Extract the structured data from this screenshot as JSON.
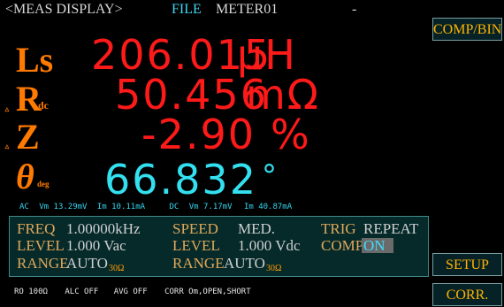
{
  "title_bar": {
    "mode": "<MEAS DISPLAY>",
    "file_label": "FILE",
    "file_name": "METER01",
    "dash": "-"
  },
  "side_buttons": {
    "comp_bin": "COMP/BIN",
    "setup": "SETUP",
    "corr": "CORR."
  },
  "readings": [
    {
      "label": "Ls",
      "sub": "",
      "prefix": "",
      "value": "206.015",
      "unit": "μH",
      "color": "#ff1a1a"
    },
    {
      "label": "R",
      "sub": "dc",
      "prefix": "▵",
      "value": "50.456",
      "unit": "mΩ",
      "color": "#ff1a1a"
    },
    {
      "label": "Z",
      "sub": "",
      "prefix": "▵",
      "value": "-2.90",
      "unit": "%",
      "color": "#ff1a1a"
    },
    {
      "label": "θ",
      "sub": "deg",
      "prefix": "",
      "value": "66.832",
      "unit": "°",
      "color": "#33e0f0"
    }
  ],
  "monitor": {
    "ac": "AC",
    "ac_vm": "Vm 13.29mV",
    "ac_im": "Im 10.11mA",
    "dc": "DC",
    "dc_vm": "Vm 7.17mV",
    "dc_im": "Im 40.87mA"
  },
  "params": {
    "freq_label": "FREQ",
    "freq_value": "1.00000kHz",
    "speed_label": "SPEED",
    "speed_value": "MED.",
    "trig_label": "TRIG",
    "trig_value": "REPEAT",
    "level_ac_label": "LEVEL",
    "level_ac_value": "1.000 Vac",
    "level_dc_label": "LEVEL",
    "level_dc_value": "1.000 Vdc",
    "comp_label": "COMP",
    "comp_value": "ON",
    "range_ac_label": "RANGE",
    "range_ac_value": "AUTO",
    "range_ac_ohm": "30Ω",
    "range_dc_label": "RANGE",
    "range_dc_value": "AUTO",
    "range_dc_ohm": "30Ω"
  },
  "status": {
    "ro": "RO 100Ω",
    "alc": "ALC OFF",
    "avg": "AVG OFF",
    "corr": "CORR Om,OPEN,SHORT"
  }
}
